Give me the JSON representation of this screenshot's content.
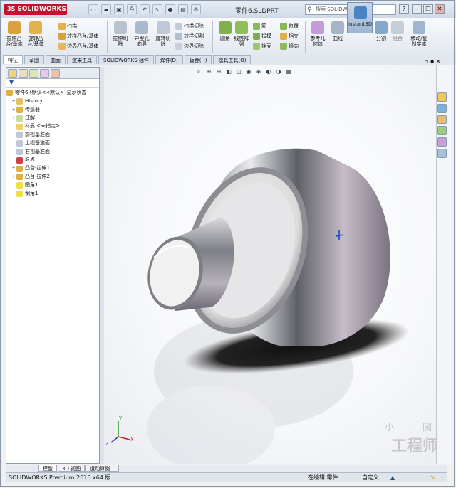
{
  "app": {
    "logo_prefix": "3S",
    "logo_text": "SOLIDWORKS",
    "file_title": "零件6.SLDPRT"
  },
  "search": {
    "placeholder": "搜索 SOLIDWORKS 帮助"
  },
  "ribbon": {
    "extrude_boss": "拉伸凸\n台/基体",
    "revolve_boss": "旋转凸\n台/基体",
    "sweep": "扫描",
    "loft_boss": "放样凸台/基体",
    "boundary_boss": "边界凸台/基体",
    "extrude_cut": "拉伸切\n除",
    "hole_wizard": "异型孔\n向导",
    "revolve_cut": "旋转切\n除",
    "sweep_cut": "扫描切除",
    "loft_cut": "放样切割",
    "boundary_cut": "边界切除",
    "fillet": "圆角",
    "linear_pattern": "线性阵\n列",
    "rib": "筋",
    "draft": "拔模",
    "shell": "抽壳",
    "wrap": "包覆",
    "intersect": "相交",
    "mirror": "镜向",
    "ref_geometry": "参考几\n何体",
    "curves": "曲线",
    "instant3d": "Instant3D",
    "split": "分割",
    "combine": "组合",
    "move_copy": "移动/复\n制实体"
  },
  "tabs": [
    "特征",
    "草图",
    "曲面",
    "渲染工具",
    "SOLIDWORKS 插件",
    "焊件(D)",
    "钣金(H)",
    "模具工具(O)"
  ],
  "tree": {
    "root": "零件6 (默认<<默认>_显示状态",
    "items": [
      "History",
      "传感器",
      "注解",
      "材质 <未指定>",
      "前视基准面",
      "上视基准面",
      "右视基准面",
      "原点",
      "凸台-拉伸1",
      "凸台-拉伸2",
      "圆角1",
      "倒角1"
    ]
  },
  "bottom_tabs": [
    "模型",
    "3D 视图",
    "运动算例 1"
  ],
  "status": {
    "left": "SOLIDWORKS Premium 2015 x64 版",
    "editing": "在编辑 零件",
    "custom": "自定义"
  },
  "watermark": {
    "line1": "小 國",
    "line2": "工程师"
  },
  "colors": {
    "accent": "#c8102e",
    "model_metal": "#b8bcc6",
    "highlight": "#4a84c4"
  }
}
